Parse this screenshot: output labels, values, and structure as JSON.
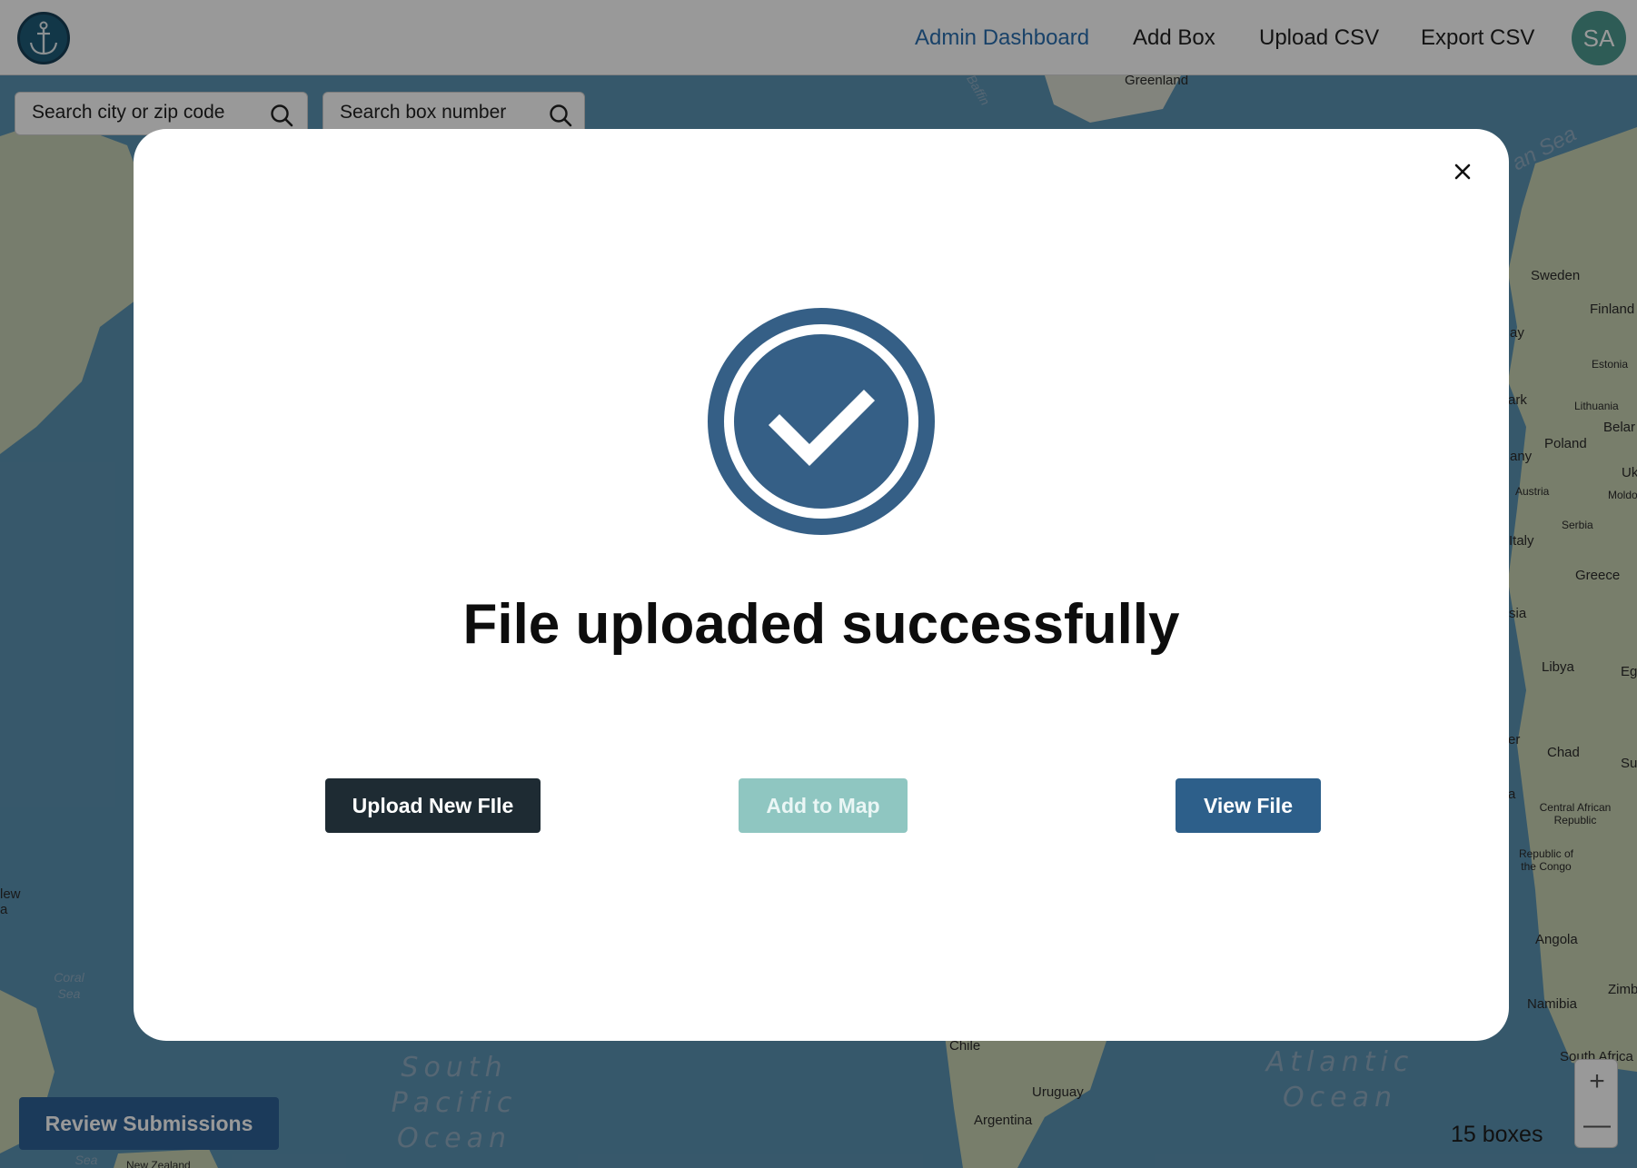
{
  "nav": {
    "items": [
      {
        "label": "Admin Dashboard",
        "active": true
      },
      {
        "label": "Add Box",
        "active": false
      },
      {
        "label": "Upload CSV",
        "active": false
      },
      {
        "label": "Export CSV",
        "active": false
      }
    ],
    "avatar_initials": "SA"
  },
  "search": {
    "city_placeholder": "Search city or zip code",
    "box_placeholder": "Search box number"
  },
  "map": {
    "labels": [
      "Greenland",
      "Sweden",
      "Finland",
      "Estonia",
      "Lithuania",
      "Belar",
      "Poland",
      "Uk",
      "Moldo",
      "Austria",
      "Serbia",
      "Italy",
      "Greece",
      "Libya",
      "Eg",
      "Chad",
      "Su",
      "Central African Republic",
      "Republic of the Congo",
      "Angola",
      "Zimb",
      "Namibia",
      "South Africa",
      "Chile",
      "Uruguay",
      "Argentina",
      "New Zealand",
      "ark",
      "any",
      "sia",
      "ay",
      "er",
      "a",
      "lew a"
    ],
    "oceans": [
      "South Pacific Ocean",
      "Atlantic Ocean"
    ],
    "seas": [
      "Coral Sea",
      "Sea",
      "Baffin",
      "an Sea"
    ]
  },
  "review_button": "Review Submissions",
  "box_count": "15 boxes",
  "zoom": {
    "in": "+",
    "out": "—"
  },
  "modal": {
    "title": "File uploaded successfully",
    "buttons": {
      "upload_new": "Upload New FIle",
      "add_to_map": "Add to Map",
      "view_file": "View File"
    }
  },
  "colors": {
    "primary_blue": "#2d5f8a",
    "dark": "#1e2b33",
    "teal_disabled": "#8fc6c1",
    "icon_blue": "#355f86"
  },
  "icons": {
    "logo": "anchor-icon",
    "search": "search-icon",
    "close": "close-icon",
    "success": "check-circle-icon"
  }
}
